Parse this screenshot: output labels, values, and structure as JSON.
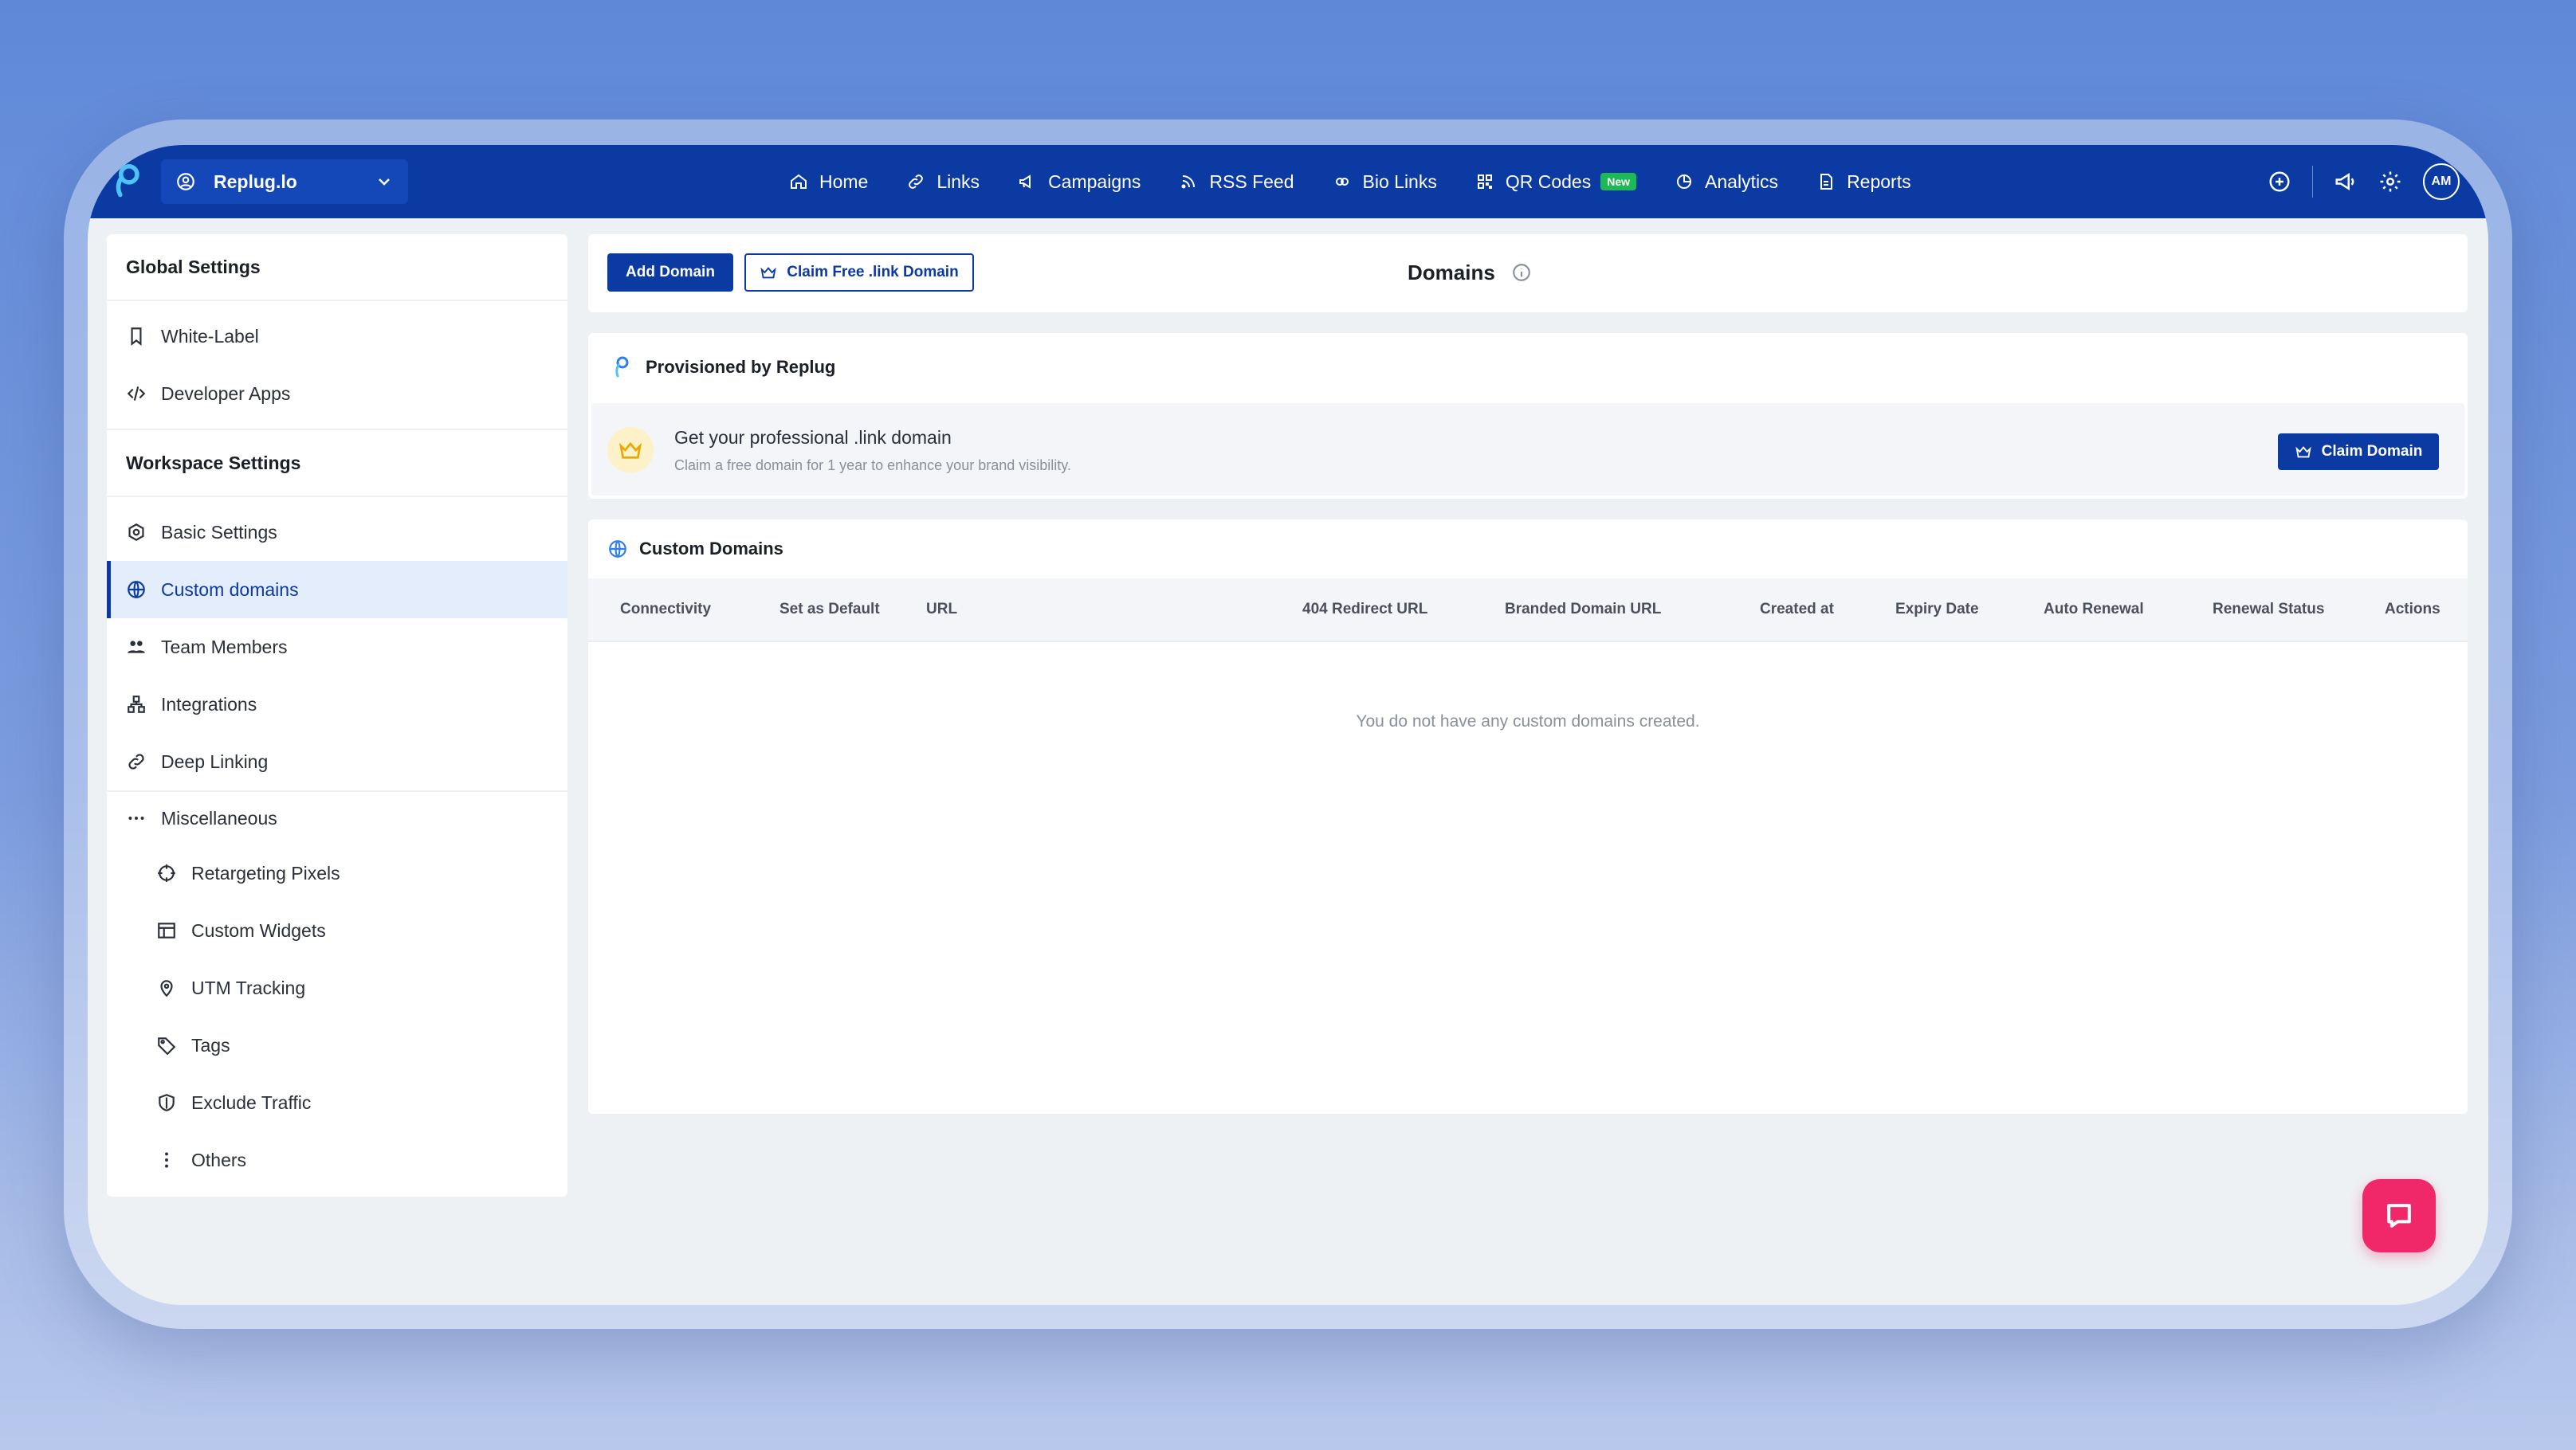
{
  "workspace": {
    "name": "Replug.lo"
  },
  "nav": {
    "items": [
      {
        "label": "Home",
        "icon": "home-icon"
      },
      {
        "label": "Links",
        "icon": "link-icon"
      },
      {
        "label": "Campaigns",
        "icon": "megaphone-icon"
      },
      {
        "label": "RSS Feed",
        "icon": "rss-icon"
      },
      {
        "label": "Bio Links",
        "icon": "bio-link-icon"
      },
      {
        "label": "QR Codes",
        "icon": "qr-icon",
        "badge": "New"
      },
      {
        "label": "Analytics",
        "icon": "analytics-icon"
      },
      {
        "label": "Reports",
        "icon": "report-icon"
      }
    ],
    "avatar_initials": "AM"
  },
  "sidebar": {
    "global_title": "Global Settings",
    "global_items": [
      {
        "label": "White-Label",
        "icon": "bookmark-icon"
      },
      {
        "label": "Developer Apps",
        "icon": "code-icon"
      }
    ],
    "workspace_title": "Workspace Settings",
    "workspace_items": [
      {
        "label": "Basic Settings",
        "icon": "gear-icon"
      },
      {
        "label": "Custom domains",
        "icon": "globe-icon",
        "active": true
      },
      {
        "label": "Team Members",
        "icon": "team-icon"
      },
      {
        "label": "Integrations",
        "icon": "integrations-icon"
      },
      {
        "label": "Deep Linking",
        "icon": "link-icon"
      }
    ],
    "misc_label": "Miscellaneous",
    "misc_items": [
      {
        "label": "Retargeting Pixels",
        "icon": "crosshair-icon"
      },
      {
        "label": "Custom Widgets",
        "icon": "widget-icon"
      },
      {
        "label": "UTM Tracking",
        "icon": "location-icon"
      },
      {
        "label": "Tags",
        "icon": "tag-icon"
      },
      {
        "label": "Exclude Traffic",
        "icon": "shield-icon"
      },
      {
        "label": "Others",
        "icon": "more-vertical-icon"
      }
    ]
  },
  "toolbar": {
    "add_domain": "Add Domain",
    "claim_free": "Claim Free .link Domain",
    "title": "Domains"
  },
  "provisioned": {
    "title": "Provisioned by Replug",
    "promo_title": "Get your professional .link domain",
    "promo_sub": "Claim a free domain for 1 year to enhance your brand visibility.",
    "claim_button": "Claim Domain"
  },
  "custom_domains": {
    "title": "Custom Domains",
    "columns": [
      "Connectivity",
      "Set as Default",
      "URL",
      "404 Redirect URL",
      "Branded Domain URL",
      "Created at",
      "Expiry Date",
      "Auto Renewal",
      "Renewal Status",
      "Actions"
    ],
    "empty_text": "You do not have any custom domains created."
  },
  "colors": {
    "primary": "#0b3aa2",
    "badge_new": "#1db954",
    "chat": "#f0286a"
  }
}
